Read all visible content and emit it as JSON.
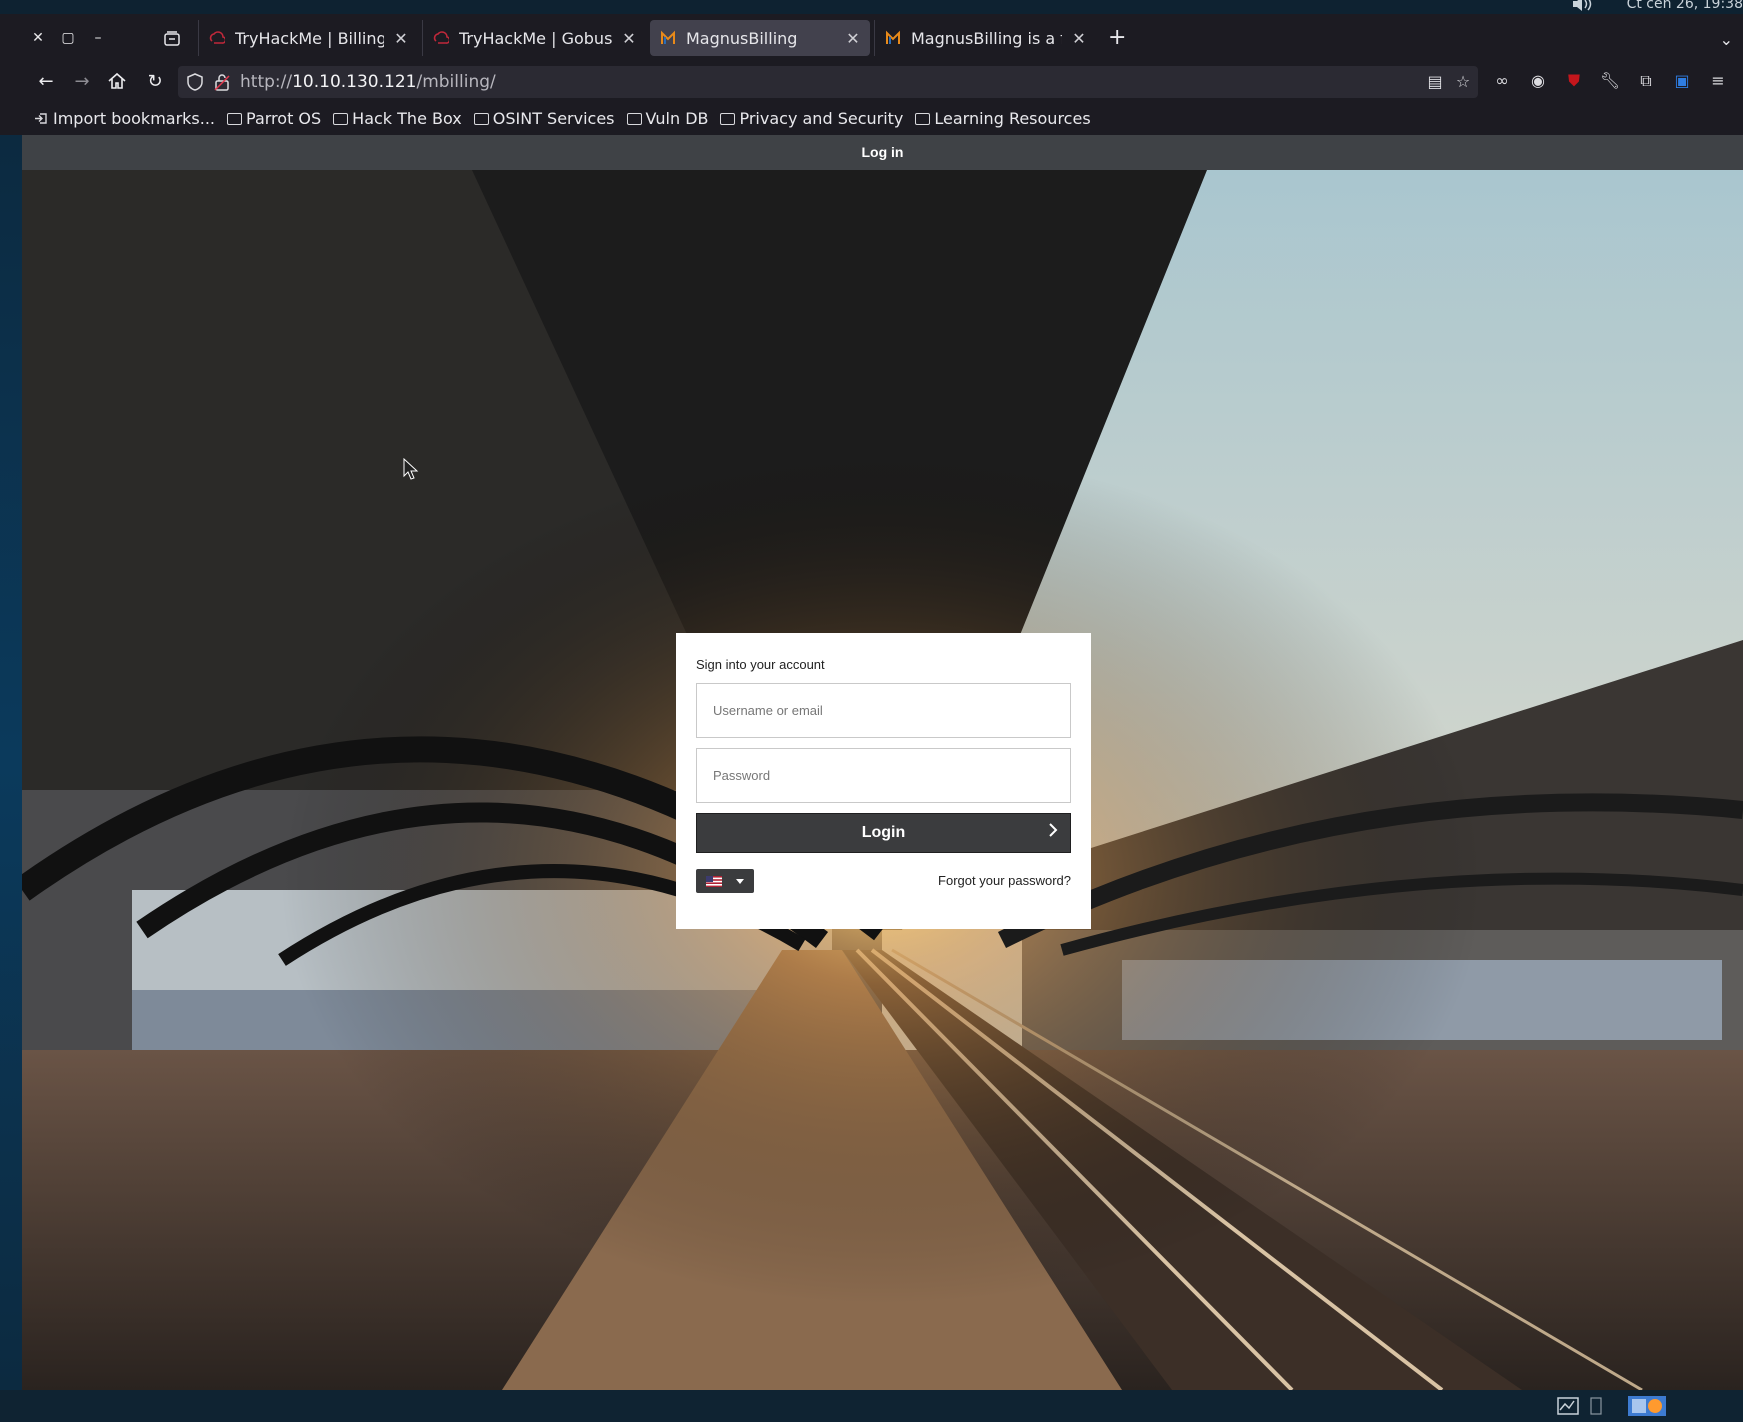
{
  "system": {
    "clock": "Čt čen 26, 19:38"
  },
  "tabs": [
    {
      "title": "TryHackMe | Billing",
      "active": false
    },
    {
      "title": "TryHackMe | Gobuster",
      "active": false
    },
    {
      "title": "MagnusBilling",
      "active": true
    },
    {
      "title": "MagnusBilling is a free",
      "active": false
    }
  ],
  "address_bar": {
    "scheme": "http://",
    "host": "10.10.130.121",
    "path": "/mbilling/"
  },
  "bookmarks": [
    {
      "label": "Import bookmarks..."
    },
    {
      "label": "Parrot OS"
    },
    {
      "label": "Hack The Box"
    },
    {
      "label": "OSINT Services"
    },
    {
      "label": "Vuln DB"
    },
    {
      "label": "Privacy and Security"
    },
    {
      "label": "Learning Resources"
    }
  ],
  "page": {
    "header_title": "Log in",
    "login": {
      "heading": "Sign into your account",
      "username_placeholder": "Username or email",
      "password_placeholder": "Password",
      "submit_label": "Login",
      "forgot_label": "Forgot your password?",
      "language": "en-US"
    }
  },
  "colors": {
    "header_bg": "#3f4246",
    "button_bg": "#3b3c3e",
    "browser_bg": "#1c1b22",
    "active_tab": "#42414d"
  }
}
